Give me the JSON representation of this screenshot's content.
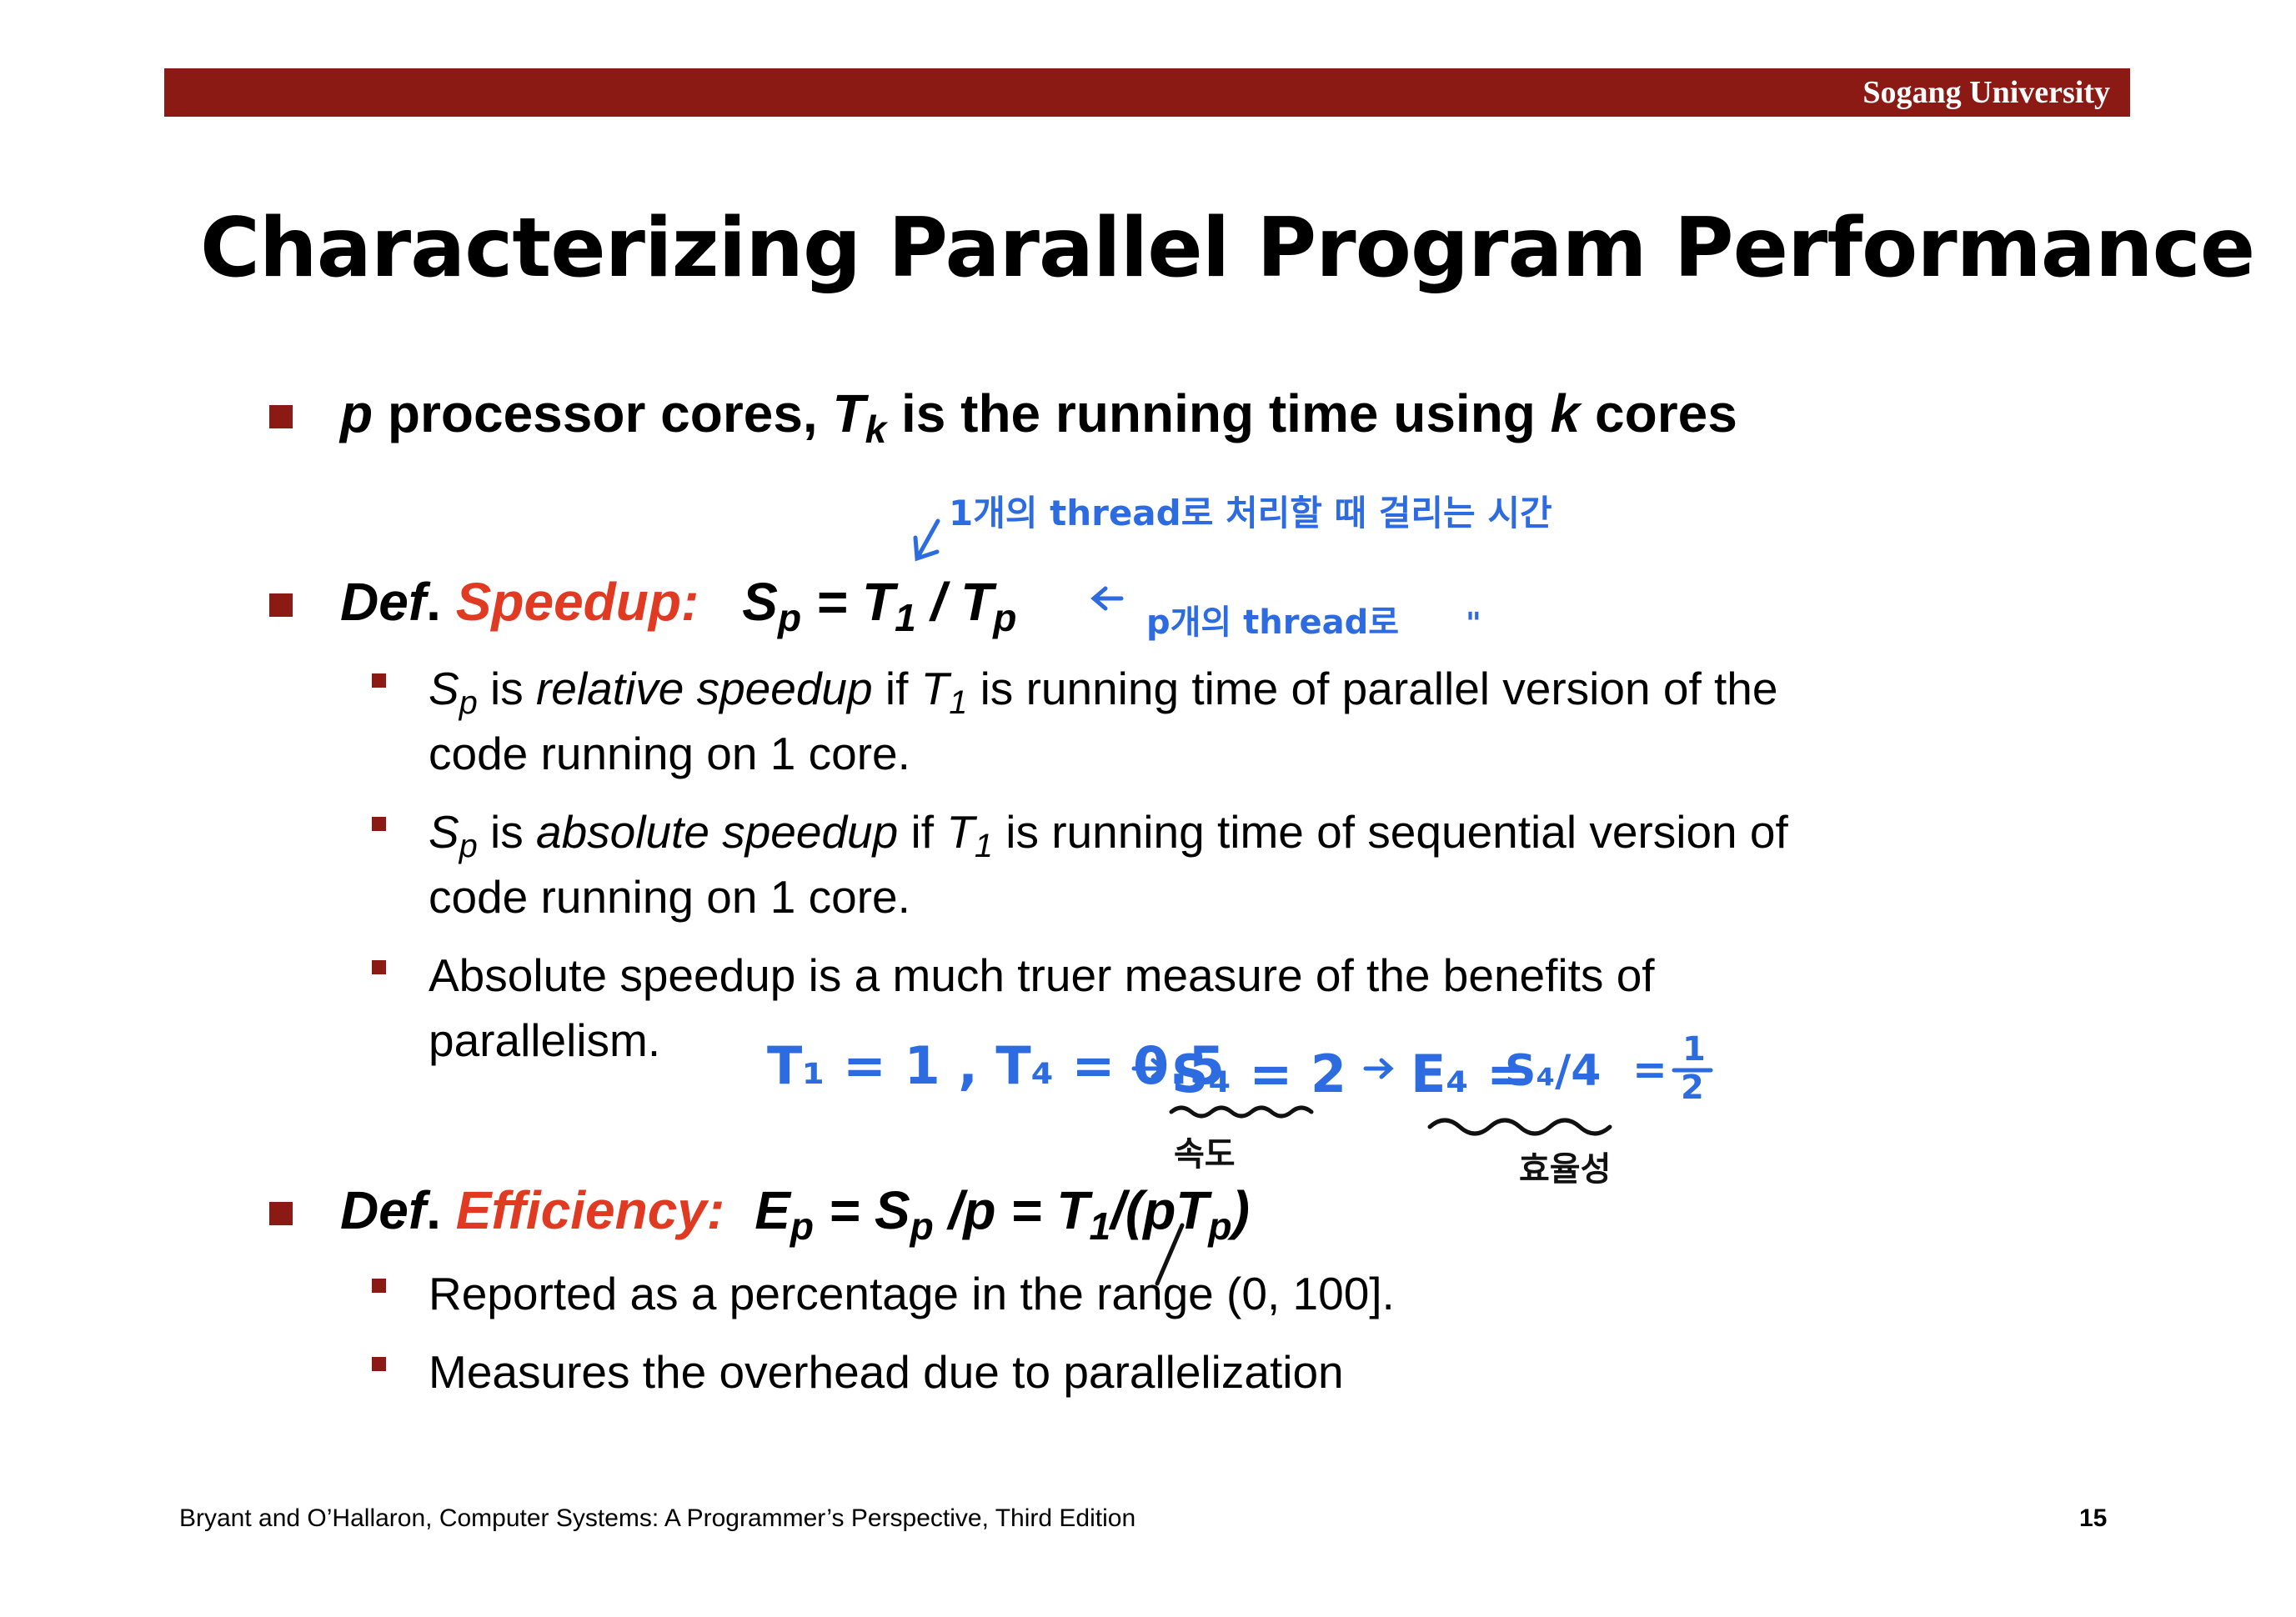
{
  "header": {
    "institution": "Sogang University"
  },
  "title": "Characterizing Parallel Program Performance",
  "bullets": {
    "b1": {
      "p": "p",
      "t1": " processor cores, ",
      "T": "T",
      "k": "k",
      "t2": " is the running time using ",
      "k2": "k",
      "t3": " cores"
    },
    "b2": {
      "def": "Def",
      "dot": ".  ",
      "term": "Speedup:",
      "formula": {
        "S": "S",
        "p": "p",
        "eq": " = T",
        "one": "1",
        "div": " / T",
        "p2": "p"
      }
    },
    "b2_sub1": {
      "S": "S",
      "p": "p",
      "t1": " is  ",
      "rel": "relative speedup",
      "t2": " if ",
      "T": "T",
      "one": "1",
      "t3": " is running time of parallel version of the",
      "line2": "code running on 1 core."
    },
    "b2_sub2": {
      "S": "S",
      "p": "p",
      "t1": " is ",
      "abs": "absolute speedup",
      "t2": " if ",
      "T": "T",
      "one": "1",
      "t3": " is running time of sequential version of",
      "line2": "code running on 1 core."
    },
    "b2_sub3": {
      "line1": "Absolute speedup is a much truer measure of the benefits of",
      "line2": "parallelism."
    },
    "b3": {
      "def": "Def",
      "dot": ".  ",
      "term": "Efficiency:",
      "formula": {
        "E": "E",
        "p": "p",
        "eq1": " = S",
        "p2": "p",
        "mid": " /p = T",
        "one": "1",
        "tail": "/(pT",
        "p3": "p",
        "close": ")"
      }
    },
    "b3_sub1": "Reported as a percentage in the range (0, 100].",
    "b3_sub2": "Measures the overhead due to parallelization"
  },
  "handwriting": {
    "note1": "1개의 thread로 처리할 때 걸리는 시간",
    "note2": "p개의 thread로",
    "note2b": "\"",
    "example": {
      "t1": "T₁ = 1 , T₄ = 0.5",
      "s4": "S₄ = 2",
      "e4": "E₄ =",
      "frac1": "S₄/4",
      "eq": "=",
      "num": "1",
      "den": "2"
    },
    "label_speed": "속도",
    "label_eff": "효율성",
    "ink_blue": "#2d6be0",
    "ink_black": "#111111"
  },
  "footer": {
    "citation": "Bryant and O’Hallaron, Computer Systems: A Programmer’s Perspective, Third Edition",
    "page": "15"
  }
}
